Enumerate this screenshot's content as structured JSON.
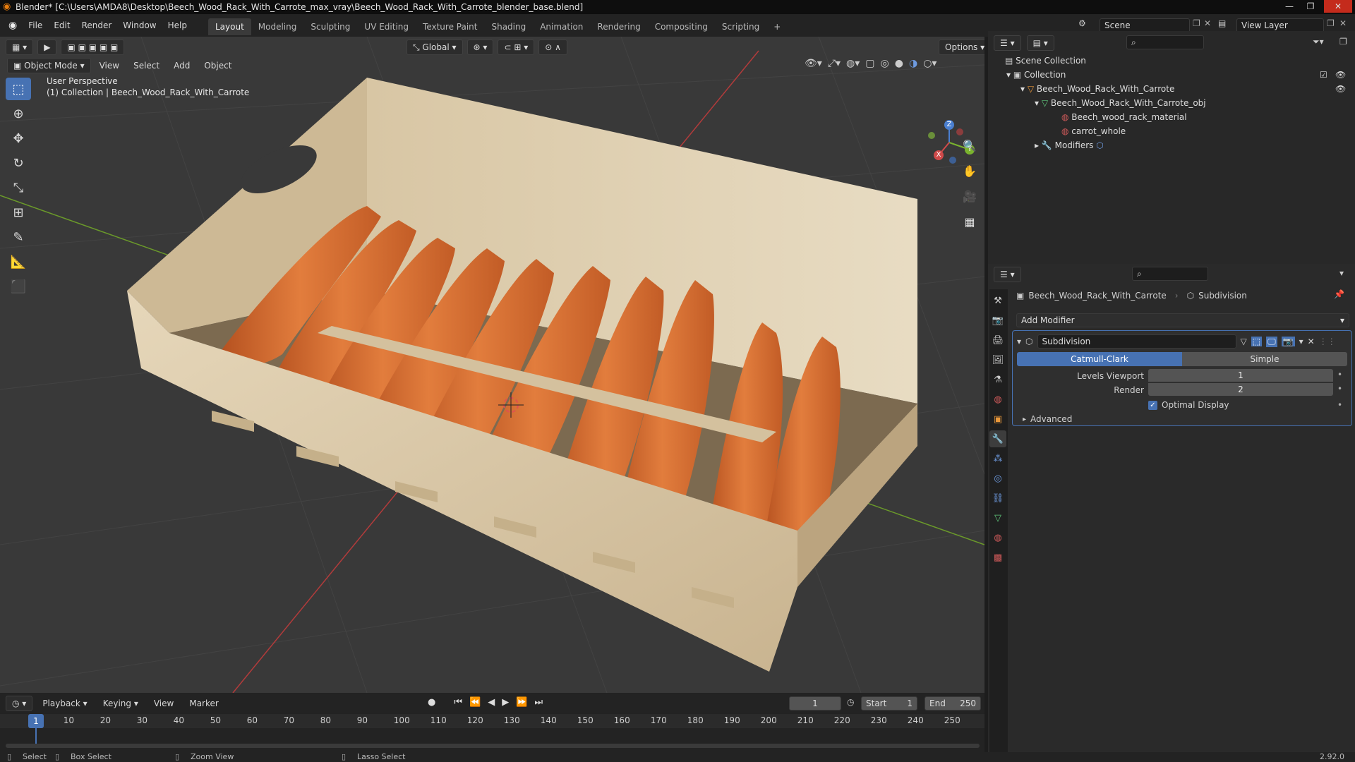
{
  "window": {
    "title": "Blender* [C:\\Users\\AMDA8\\Desktop\\Beech_Wood_Rack_With_Carrote_max_vray\\Beech_Wood_Rack_With_Carrote_blender_base.blend]",
    "minimize": "—",
    "maximize": "❐",
    "close": "✕"
  },
  "menu": {
    "items": [
      "File",
      "Edit",
      "Render",
      "Window",
      "Help"
    ]
  },
  "workspaces": [
    "Layout",
    "Modeling",
    "Sculpting",
    "UV Editing",
    "Texture Paint",
    "Shading",
    "Animation",
    "Rendering",
    "Compositing",
    "Scripting"
  ],
  "add_workspace": "+",
  "scene": {
    "label": "Scene",
    "view_layer": "View Layer"
  },
  "viewport": {
    "mode": "Object Mode",
    "menus": [
      "View",
      "Select",
      "Add",
      "Object"
    ],
    "transform_orientation": "Global",
    "options": "Options",
    "overlay_title": "User Perspective",
    "overlay_subtitle": "(1) Collection | Beech_Wood_Rack_With_Carrote",
    "gizmo": {
      "x": "X",
      "y": "Y",
      "z": "Z"
    }
  },
  "timeline": {
    "menus": [
      "Playback",
      "Keying",
      "View",
      "Marker"
    ],
    "current_frame": "1",
    "start_label": "Start",
    "start": "1",
    "end_label": "End",
    "end": "250",
    "ticks": [
      "1",
      "10",
      "20",
      "30",
      "40",
      "50",
      "60",
      "70",
      "80",
      "90",
      "100",
      "110",
      "120",
      "130",
      "140",
      "150",
      "160",
      "170",
      "180",
      "190",
      "200",
      "210",
      "220",
      "230",
      "240",
      "250"
    ]
  },
  "status": {
    "select": "Select",
    "box_select": "Box Select",
    "zoom": "Zoom View",
    "lasso": "Lasso Select",
    "version": "2.92.0"
  },
  "outliner": {
    "root": "Scene Collection",
    "items": [
      {
        "label": "Collection",
        "depth": 0
      },
      {
        "label": "Beech_Wood_Rack_With_Carrote",
        "depth": 1
      },
      {
        "label": "Beech_Wood_Rack_With_Carrote_obj",
        "depth": 2
      },
      {
        "label": "Beech_wood_rack_material",
        "depth": 3
      },
      {
        "label": "carrot_whole",
        "depth": 3
      },
      {
        "label": "Modifiers",
        "depth": 2
      }
    ]
  },
  "properties": {
    "breadcrumb_object": "Beech_Wood_Rack_With_Carrote",
    "breadcrumb_modifier": "Subdivision",
    "add_modifier": "Add Modifier",
    "modifier_name": "Subdivision",
    "method_a": "Catmull-Clark",
    "method_b": "Simple",
    "levels_viewport_label": "Levels Viewport",
    "levels_viewport": "1",
    "render_label": "Render",
    "render": "2",
    "optimal_display": "Optimal Display",
    "advanced": "Advanced"
  },
  "colors": {
    "accent": "#4772b3",
    "viewport_bg": "#393939",
    "wood": "#dcc9a8",
    "carrot": "#d56a2f"
  }
}
